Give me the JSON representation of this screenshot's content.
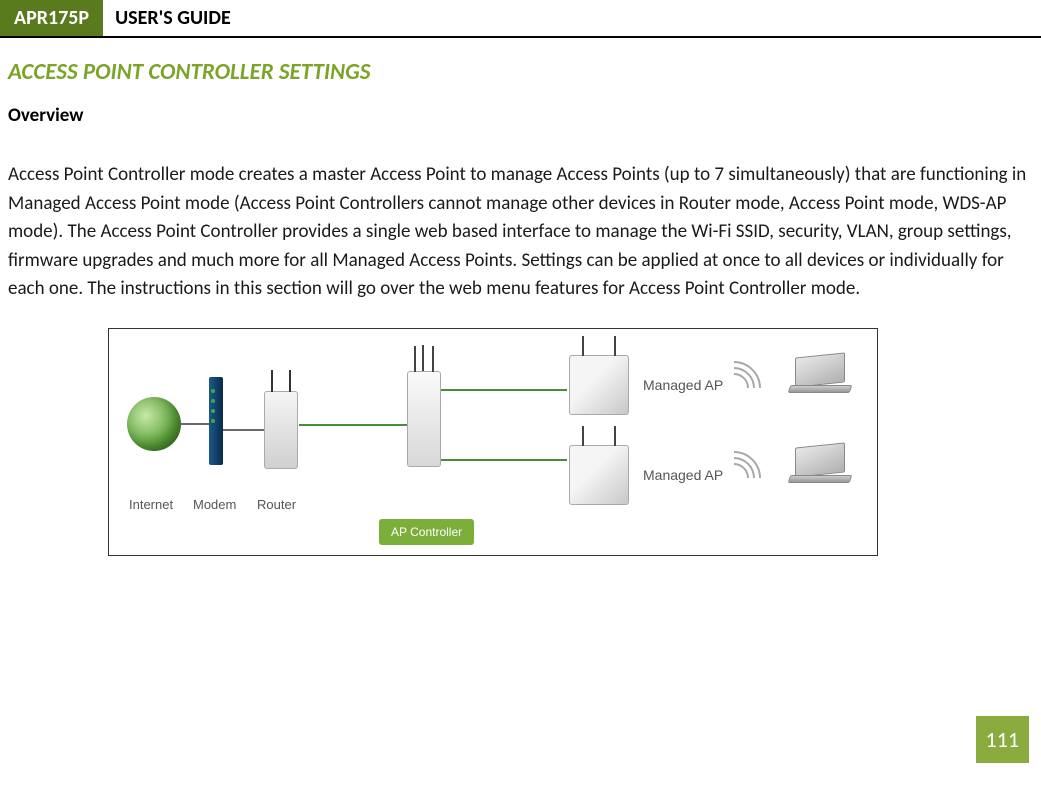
{
  "header": {
    "model": "APR175P",
    "title": "USER'S GUIDE"
  },
  "section": {
    "heading": "ACCESS POINT CONTROLLER SETTINGS",
    "subheading": "Overview",
    "body": "Access Point Controller mode creates a master Access Point to manage Access Points (up to 7 simultaneously) that are functioning in Managed Access Point mode (Access Point Controllers cannot manage other devices in Router mode, Access Point mode, WDS-AP mode).  The Access Point Controller provides a single web based interface to manage the Wi-Fi SSID, security, VLAN, group settings, firmware upgrades and much more for all Managed Access Points.  Settings can be applied at once to all devices or individually for each one.  The instructions in this section will go over the web menu features for Access Point Controller mode."
  },
  "diagram": {
    "internet_label": "Internet",
    "modem_label": "Modem",
    "router_label": "Router",
    "ap_controller_badge": "AP Controller",
    "managed_ap_label_top": "Managed AP",
    "managed_ap_label_bottom": "Managed AP"
  },
  "page_number": "111"
}
